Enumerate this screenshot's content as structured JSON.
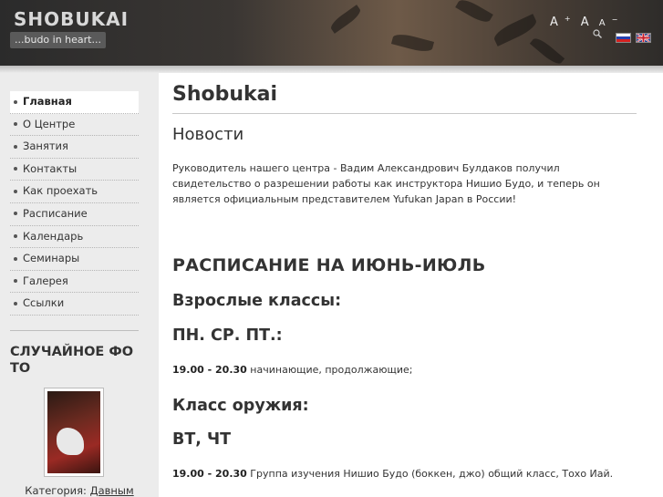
{
  "header": {
    "site_title": "SHOBUKAI",
    "tagline": "...budo in heart...",
    "font_increase": "A",
    "font_increase_sup": "+",
    "font_reset": "A",
    "font_decrease": "A",
    "font_decrease_sup": "−"
  },
  "sidebar": {
    "menu": [
      {
        "label": "Главная"
      },
      {
        "label": "О Центре"
      },
      {
        "label": "Занятия"
      },
      {
        "label": "Контакты"
      },
      {
        "label": "Как проехать"
      },
      {
        "label": "Расписание"
      },
      {
        "label": "Календарь"
      },
      {
        "label": "Семинары"
      },
      {
        "label": "Галерея"
      },
      {
        "label": "Ссылки"
      }
    ],
    "random_photo_title": "СЛУЧАЙНОЕ ФОТО",
    "category_label": "Категория:",
    "category_link": "Давным"
  },
  "main": {
    "page_title": "Shobukai",
    "news_heading": "Новости",
    "news_text": "Руководитель нашего центра - Вадим Александрович Булдаков получил свидетельство о разрешении работы как инструктора Нишио Будо, и теперь он является официальным представителем Yufukan Japan в России!",
    "schedule_heading": "РАСПИСАНИЕ НА ИЮНЬ-ИЮЛЬ",
    "adult_heading": "Взрослые классы:",
    "adult_days": "ПН. СР. ПТ.:",
    "adult_time": "19.00 - 20.30",
    "adult_desc": " начинающие, продолжающие;",
    "weapon_heading": "Класс оружия:",
    "weapon_days": "ВТ, ЧТ",
    "weapon_time": "19.00 - 20.30",
    "weapon_desc": " Группа изучения Нишио Будо (боккен, джо) общий класс, Тохо Иай."
  }
}
